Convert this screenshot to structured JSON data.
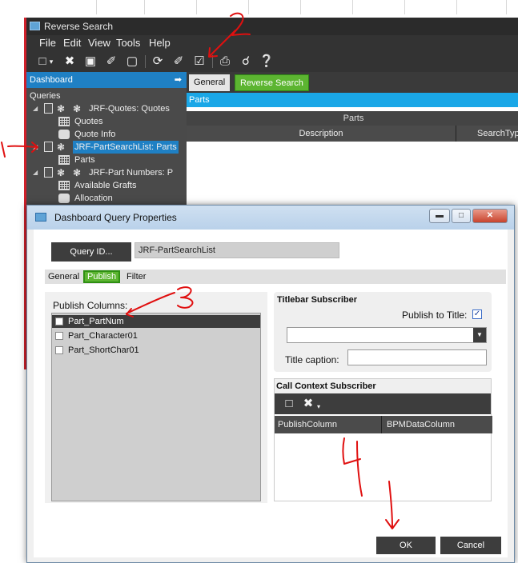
{
  "app": {
    "title": "Reverse Search",
    "menu": [
      "File",
      "Edit",
      "View",
      "Tools",
      "Help"
    ],
    "toolbar_icons": [
      "new-icon",
      "dropdown-icon",
      "delete-icon",
      "save-icon",
      "clear-icon",
      "blank-icon",
      "refresh-icon",
      "brush-icon",
      "checklist-icon",
      "print-icon",
      "print-preview-icon",
      "help-icon"
    ]
  },
  "dashboard": {
    "header": "Dashboard",
    "pin": "ᛘ",
    "section": "Queries",
    "items": [
      {
        "label": "JRF-Quotes: Quotes",
        "type": "query"
      },
      {
        "label": "Quotes",
        "type": "grid"
      },
      {
        "label": "Quote Info",
        "type": "db"
      },
      {
        "label": "JRF-PartSearchList: Parts",
        "type": "query",
        "selected": true
      },
      {
        "label": "Parts",
        "type": "grid"
      },
      {
        "label": "JRF-Part Numbers: P",
        "type": "query"
      },
      {
        "label": "Available Grafts",
        "type": "grid"
      },
      {
        "label": "Allocation",
        "type": "db"
      }
    ]
  },
  "main": {
    "tabs": [
      "General",
      "Reverse Search"
    ],
    "panel_title": "Parts",
    "grid_title": "Parts",
    "columns": [
      "Description",
      "SearchTyp"
    ]
  },
  "dialog": {
    "title": "Dashboard Query Properties",
    "window_buttons": [
      "minimize",
      "maximize",
      "close"
    ],
    "query_id_button": "Query ID...",
    "query_id_value": "JRF-PartSearchList",
    "tabs": [
      "General",
      "Publish",
      "Filter"
    ],
    "publish_columns_label": "Publish Columns:",
    "publish_columns": [
      {
        "name": "Part_PartNum",
        "checked": true
      },
      {
        "name": "Part_Character01",
        "checked": false
      },
      {
        "name": "Part_ShortChar01",
        "checked": false
      }
    ],
    "titlebar_subscriber": {
      "header": "Titlebar Subscriber",
      "publish_to_title_label": "Publish to Title:",
      "publish_to_title_checked": true,
      "title_caption_label": "Title caption:"
    },
    "call_context": {
      "header": "Call Context Subscriber",
      "columns": [
        "PublishColumn",
        "BPMDataColumn"
      ]
    },
    "ok_label": "OK",
    "cancel_label": "Cancel"
  },
  "annotations": [
    "1",
    "2",
    "3",
    "4"
  ],
  "colors": {
    "accent_blue": "#1f80c4",
    "tab_green": "#5cb531",
    "annotation_red": "#e01010"
  }
}
